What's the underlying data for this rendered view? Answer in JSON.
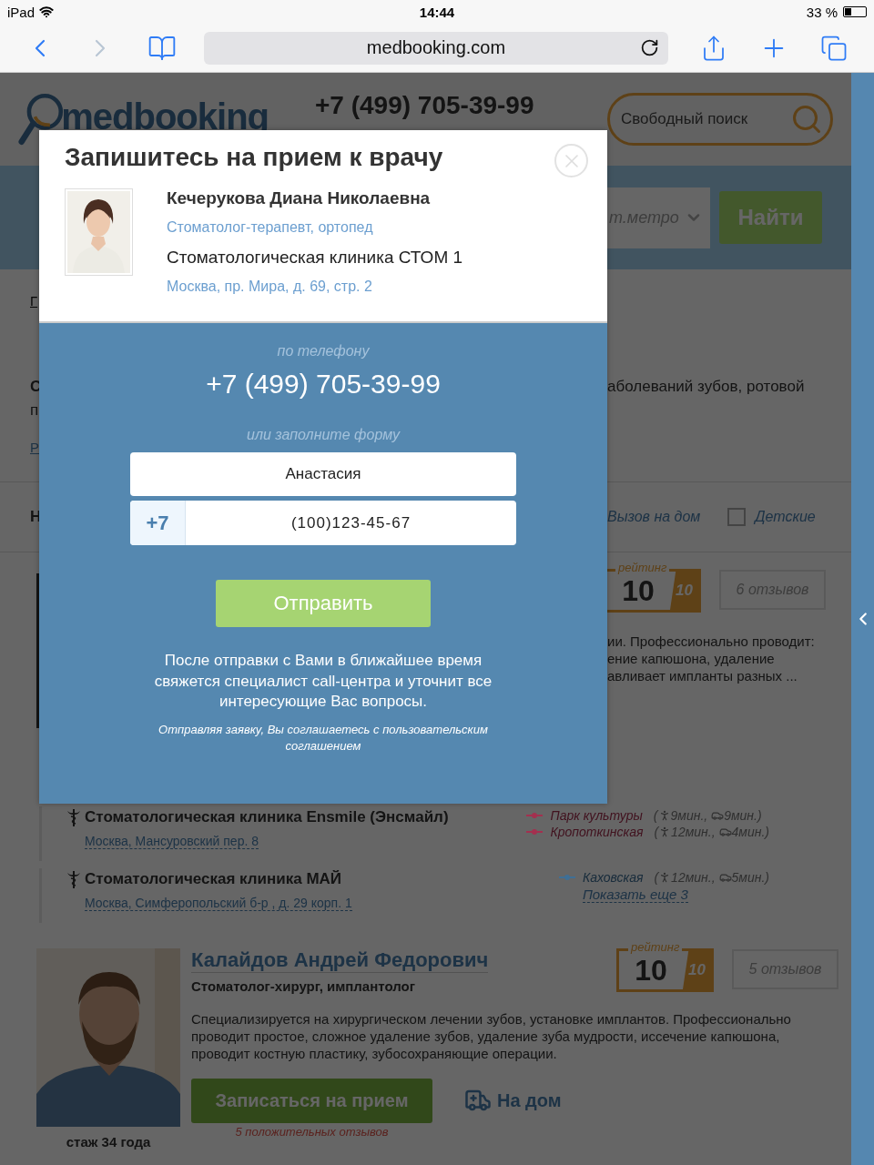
{
  "status_bar": {
    "device": "iPad",
    "time": "14:44",
    "battery": "33 %"
  },
  "browser": {
    "url": "medbooking.com"
  },
  "page": {
    "header": {
      "logo": "medbooking",
      "phone": "+7 (499) 705-39-99",
      "search_placeholder": "Свободный поиск"
    },
    "search_bar": {
      "metro_placeholder": "т.метро",
      "button": "Найти"
    },
    "breadcrumb": "Г",
    "intro": {
      "left": "С",
      "right": "аболеваний зубов, ротовой",
      "second": "п",
      "link": "Р"
    },
    "filters": {
      "left": "Н",
      "home_visit": "Вызов на дом",
      "children": {
        "label": "Детские",
        "checked": false
      }
    },
    "doctor_1": {
      "rating_label": "рейтинг",
      "rating": "10",
      "rating_max": "10",
      "reviews": "6 отзывов",
      "description": [
        "ии. Профессионально проводит:",
        "ение капюшона, удаление",
        "авливает импланты разных ..."
      ]
    },
    "clinics": [
      {
        "name": "Стоматологическая клиника Ensmile (Энсмайл)",
        "address": "Москва, Мансуровский пер. 8",
        "metro": [
          {
            "name": "Парк культуры",
            "color": "#a3304f",
            "open": "(",
            "walk": "9мин.,",
            "car": "9мин.)"
          },
          {
            "name": "Кропоткинская",
            "color": "#a3304f",
            "open": "(",
            "walk": "12мин.,",
            "car": "4мин.)"
          }
        ]
      },
      {
        "name": "Стоматологическая клиника МАЙ",
        "address": "Москва, Симферопольский б-р , д. 29 корп. 1",
        "metro": [
          {
            "name": "Каховская",
            "color": "#3f6f95",
            "open": "(",
            "walk": "12мин.,",
            "car": "5мин.)"
          }
        ],
        "more": "Показать еще 3"
      }
    ],
    "doctor_2": {
      "name": "Калайдов Андрей Федорович",
      "specialty": "Стоматолог-хирург, имплантолог",
      "experience": "стаж 34 года",
      "description": "Специализируется на хирургическом лечении зубов, установке имплантов. Профессионально проводит простое, сложное удаление зубов, удаление зуба мудрости, иссечение капюшона, проводит костную пластику, зубосохраняющие операции.",
      "book_button": "Записаться на прием",
      "home_visit": "На дом",
      "positive": "5 положительных отзывов",
      "rating_label": "рейтинг",
      "rating": "10",
      "rating_max": "10",
      "reviews": "5 отзывов"
    }
  },
  "modal": {
    "title": "Запишитесь на прием к врачу",
    "doctor": {
      "name": "Кечерукова Диана Николаевна",
      "specialty": "Стоматолог-терапевт, ортопед",
      "clinic": "Стоматологическая клиника СТОМ 1",
      "address": "Москва, пр. Мира, д. 69, стр. 2"
    },
    "phone_label": "по телефону",
    "phone": "+7 (499) 705-39-99",
    "form_label": "или заполните форму",
    "name_value": "Анастасия",
    "phone_prefix": "+7",
    "phone_value": "(100)123-45-67",
    "submit": "Отправить",
    "note": "После отправки с Вами в ближайшее время свяжется специалист call-центра и уточнит все интересующие Вас вопросы.",
    "agreement": "Отправляя заявку, Вы соглашаетесь с пользовательским соглашением"
  }
}
